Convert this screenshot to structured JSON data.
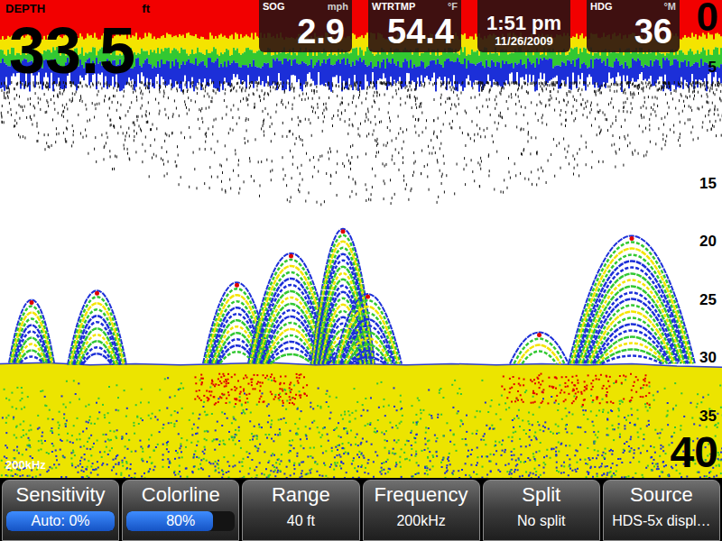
{
  "depth": {
    "label": "DEPTH",
    "unit": "ft",
    "value": "33.5"
  },
  "gauges": [
    {
      "kind": "reading",
      "label": "SOG",
      "unit": "mph",
      "value": "2.9"
    },
    {
      "kind": "reading",
      "label": "WTRTMP",
      "unit": "°F",
      "value": "54.4"
    },
    {
      "kind": "clock",
      "time": "1:51 pm",
      "date": "11/26/2009"
    },
    {
      "kind": "reading",
      "label": "HDG",
      "unit": "°M",
      "value": "36"
    }
  ],
  "scale": {
    "min": "0",
    "max": "40",
    "ticks": [
      "5",
      "15",
      "20",
      "25",
      "30",
      "35"
    ]
  },
  "frequency_label": "200kHz",
  "sonar": {
    "bottom": [
      30.5,
      30.4,
      30.6,
      30.5,
      30.6,
      30.5,
      30.4,
      30.6,
      30.5,
      30.6,
      30.5,
      30.6,
      30.5,
      30.6,
      30.5,
      30.7,
      30.8
    ],
    "echoes": [
      {
        "from": 10,
        "to": 60,
        "top": 25.0
      },
      {
        "from": 75,
        "to": 140,
        "top": 24.2
      },
      {
        "from": 225,
        "to": 300,
        "top": 23.5
      },
      {
        "from": 275,
        "to": 370,
        "top": 21.0
      },
      {
        "from": 345,
        "to": 415,
        "top": 18.9
      },
      {
        "from": 370,
        "to": 445,
        "top": 24.5
      },
      {
        "from": 565,
        "to": 630,
        "top": 27.8
      },
      {
        "from": 630,
        "to": 770,
        "top": 19.5
      }
    ]
  },
  "menu": [
    {
      "kind": "slider",
      "label": "Sensitivity",
      "value": "Auto: 0%",
      "level": 1.0
    },
    {
      "kind": "slider",
      "label": "Colorline",
      "value": "80%",
      "level": 0.8
    },
    {
      "kind": "option",
      "label": "Range",
      "value": "40 ft"
    },
    {
      "kind": "option",
      "label": "Frequency",
      "value": "200kHz"
    },
    {
      "kind": "option",
      "label": "Split",
      "value": "No split"
    },
    {
      "kind": "option",
      "label": "Source",
      "value": "HDS-5x displ…"
    }
  ]
}
